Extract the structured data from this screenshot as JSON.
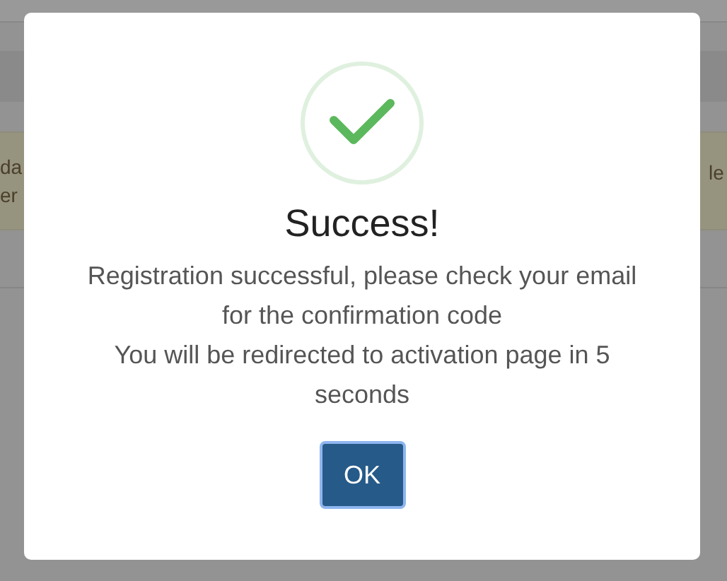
{
  "background": {
    "alert": {
      "left_lines": [
        "da",
        "er"
      ],
      "right_lines": [
        "le"
      ]
    }
  },
  "dialog": {
    "title": "Success!",
    "message_lines": [
      "Registration successful, please check your email for the confirmation code",
      "You will be redirected to activation page in 5 seconds"
    ],
    "button": "OK"
  }
}
